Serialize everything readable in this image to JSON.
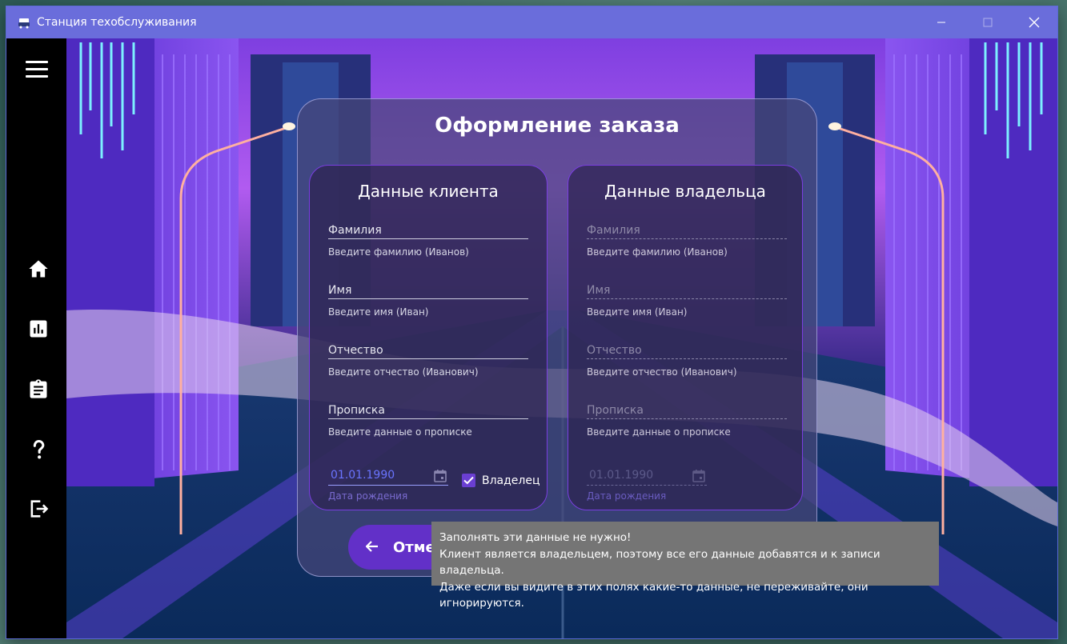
{
  "window": {
    "title": "Станция техобслуживания",
    "controls": [
      "minimize",
      "maximize",
      "close"
    ]
  },
  "sidebar": {
    "items": [
      {
        "name": "menu-icon",
        "icon": "hamburger"
      },
      {
        "name": "home-icon",
        "icon": "home"
      },
      {
        "name": "chart-icon",
        "icon": "bar-chart"
      },
      {
        "name": "clipboard-icon",
        "icon": "clipboard"
      },
      {
        "name": "help-icon",
        "icon": "question-mark"
      },
      {
        "name": "logout-icon",
        "icon": "exit"
      }
    ]
  },
  "order": {
    "title": "Оформление заказа",
    "client": {
      "title": "Данные клиента",
      "fields": [
        {
          "label": "Фамилия",
          "hint": "Введите фамилию (Иванов)"
        },
        {
          "label": "Имя",
          "hint": "Введите имя (Иван)"
        },
        {
          "label": "Отчество",
          "hint": "Введите отчество (Иванович)"
        },
        {
          "label": "Прописка",
          "hint": "Введите данные о прописке"
        }
      ],
      "birth_date": {
        "value": "01.01.1990",
        "hint": "Дата рождения"
      },
      "owner_checkbox": {
        "label": "Владелец",
        "checked": true
      }
    },
    "owner": {
      "title": "Данные владельца",
      "fields": [
        {
          "label": "Фамилия",
          "hint": "Введите фамилию (Иванов)"
        },
        {
          "label": "Имя",
          "hint": "Введите имя (Иван)"
        },
        {
          "label": "Отчество",
          "hint": "Введите отчество (Иванович)"
        },
        {
          "label": "Прописка",
          "hint": "Введите данные о прописке"
        }
      ],
      "birth_date": {
        "value": "01.01.1990",
        "hint": "Дата рождения"
      }
    },
    "cancel_label": "Отме"
  },
  "tooltip": {
    "lines": [
      "Заполнять эти данные не нужно!",
      "Клиент является владельцем, поэтому все его данные добавятся и к записи владельца.",
      "Даже если вы видите в этих полях какие-то данные, не переживайте, они игнорируются."
    ]
  },
  "colors": {
    "titlebar": "#6a6ddb",
    "accent": "#6230c8",
    "panel_border": "#7a3ee0",
    "date_text": "#6a74ff"
  }
}
